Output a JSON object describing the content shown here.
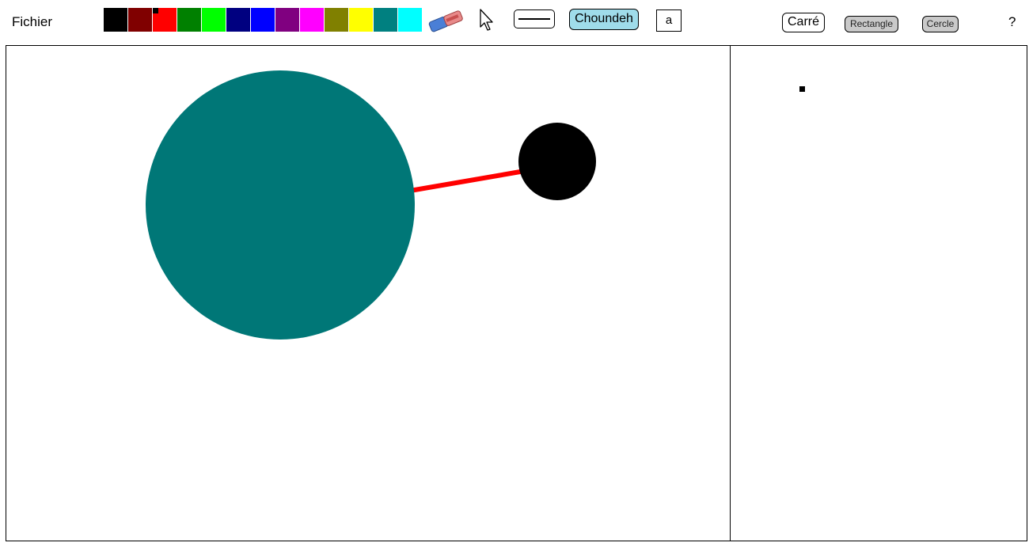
{
  "menu": {
    "file_label": "Fichier",
    "help_label": "?"
  },
  "palette": {
    "colors": [
      "#000000",
      "#800000",
      "#ff0000",
      "#008000",
      "#00ff00",
      "#000080",
      "#0000ff",
      "#800080",
      "#ff00ff",
      "#808000",
      "#ffff00",
      "#008080",
      "#00ffff"
    ],
    "selected_index": 2
  },
  "tools": {
    "eraser_icon": "eraser-icon",
    "pointer_icon": "cursor-arrow-icon",
    "line_icon": "line-stroke-icon",
    "choundeh_label": "Choundeh",
    "text_label": "a"
  },
  "shapes_toolbar": {
    "square_label": "Carré",
    "rectangle_label": "Rectangle",
    "circle_label": "Cercle"
  },
  "colors": {
    "teal_shape": "#007777",
    "line_red": "#ff0000",
    "black_shape": "#000000",
    "choundeh_bg": "#9fdcea",
    "inactive_button_bg": "#c9c9c9"
  },
  "drawing": {
    "shapes": [
      {
        "type": "circle",
        "fill": "#007777"
      },
      {
        "type": "line",
        "stroke": "#ff0000"
      },
      {
        "type": "circle",
        "fill": "#000000"
      }
    ]
  }
}
